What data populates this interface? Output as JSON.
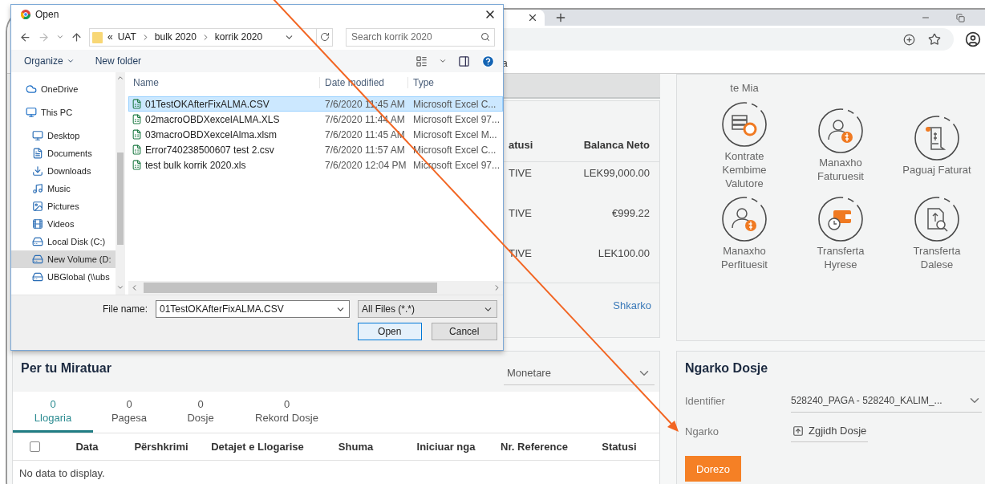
{
  "browser": {
    "bookmark": "a"
  },
  "page": {
    "accounts": {
      "columns": [
        "atusi",
        "Balanca Neto"
      ],
      "rows": [
        {
          "status": "TIVE",
          "balance": "LEK99,000.00"
        },
        {
          "status": "TIVE",
          "balance": "€999.22"
        },
        {
          "status": "TIVE",
          "balance": "LEK100.00"
        }
      ],
      "link": "Shkarko"
    },
    "actions": {
      "cut_label": "te Mia",
      "items": [
        {
          "label": "Kontrate Kembime Valutore"
        },
        {
          "label": "Manaxho Faturuesit"
        },
        {
          "label": "Paguaj Faturat"
        },
        {
          "label": "Manaxho Perfituesit"
        },
        {
          "label": "Transferta Hyrese"
        },
        {
          "label": "Transferta Dalese"
        }
      ]
    },
    "approvals": {
      "title": "Per tu Miratuar",
      "filter": "Monetare",
      "tabs": [
        {
          "count": "0",
          "label": "Llogaria",
          "selected": true
        },
        {
          "count": "0",
          "label": "Pagesa",
          "selected": false
        },
        {
          "count": "0",
          "label": "Dosje",
          "selected": false
        },
        {
          "count": "0",
          "label": "Rekord Dosje",
          "selected": false
        }
      ],
      "select_all": {
        "checked": false
      },
      "columns": [
        "Data",
        "Përshkrimi",
        "Detajet e Llogarise",
        "Shuma",
        "Iniciuar nga",
        "Nr. Reference",
        "Statusi"
      ],
      "empty_text": "No data to display."
    },
    "upload": {
      "title": "Ngarko Dosje",
      "identifier_label": "Identifier",
      "identifier_value": "528240_PAGA - 528240_KALIM_...",
      "file_label": "Ngarko",
      "file_button": "Zgjidh Dosje",
      "submit": "Dorezo"
    }
  },
  "dialog": {
    "title": "Open",
    "overflow_mark": "«",
    "path": [
      "UAT",
      "bulk  2020",
      "korrik 2020"
    ],
    "search": {
      "placeholder": "Search korrik 2020"
    },
    "toolbar": [
      "Organize",
      "New folder"
    ],
    "nav": [
      {
        "label": "OneDrive",
        "selected": false
      },
      {
        "label": "This PC",
        "selected": false,
        "children": [
          {
            "label": "Desktop",
            "selected": false
          },
          {
            "label": "Documents",
            "selected": false
          },
          {
            "label": "Downloads",
            "selected": false
          },
          {
            "label": "Music",
            "selected": false
          },
          {
            "label": "Pictures",
            "selected": false
          },
          {
            "label": "Videos",
            "selected": false
          },
          {
            "label": "Local Disk (C:)",
            "selected": false
          },
          {
            "label": "New Volume (D:",
            "selected": true
          },
          {
            "label": "UBGlobal (\\\\ubs",
            "selected": false
          }
        ]
      }
    ],
    "columns": [
      "Name",
      "Date modified",
      "Type"
    ],
    "files": [
      {
        "name": "01TestOKAfterFixALMA.CSV",
        "date": "7/6/2020 11:45 AM",
        "type": "Microsoft Excel C...",
        "selected": true
      },
      {
        "name": "02macroOBDXexcelALMA.XLS",
        "date": "7/6/2020 11:44 AM",
        "type": "Microsoft Excel 97...",
        "selected": false
      },
      {
        "name": "03macroOBDXexcelAlma.xlsm",
        "date": "7/6/2020 11:45 AM",
        "type": "Microsoft Excel M...",
        "selected": false
      },
      {
        "name": "Error740238500607 test 2.csv",
        "date": "7/6/2020 11:57 AM",
        "type": "Microsoft Excel C...",
        "selected": false
      },
      {
        "name": "test bulk korrik 2020.xls",
        "date": "7/6/2020 12:04 PM",
        "type": "Microsoft Excel 97...",
        "selected": false
      }
    ],
    "file_name_label": "File name:",
    "file_name": "01TestOKAfterFixALMA.CSV",
    "filter": "All Files (*.*)",
    "buttons": [
      "Open",
      "Cancel"
    ]
  }
}
